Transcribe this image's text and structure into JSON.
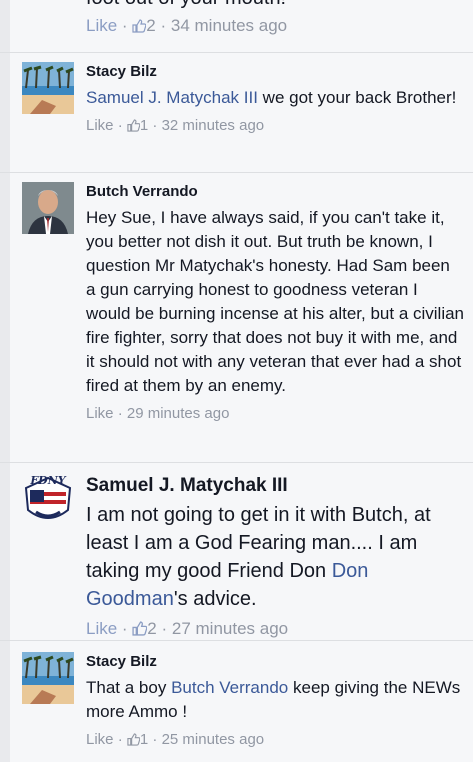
{
  "top_fragment": {
    "text": "foot out of your mouth!",
    "meta": {
      "like": "Like",
      "sep": " · ",
      "count": "2",
      "time": "34 minutes ago"
    }
  },
  "comments": [
    {
      "name": "Stacy Bilz",
      "mention": "Samuel J. Matychak III",
      "text": " we got your back Brother!",
      "meta": {
        "like": "Like",
        "sep": " · ",
        "count": "1",
        "time": "32 minutes ago"
      }
    },
    {
      "name": "Butch Verrando",
      "text": "Hey Sue, I have always said, if you can't take it, you better not dish it out. But truth be known, I question Mr Matychak's honesty. Had Sam been a gun carrying honest to goodness veteran I would be burning incense at his alter, but a civilian fire fighter, sorry that does not buy it with me, and it should not with any veteran that ever had a shot fired at them by an enemy.",
      "meta": {
        "like": "Like",
        "sep": " · ",
        "time": "29 minutes ago"
      }
    },
    {
      "name": "Samuel J. Matychak III",
      "text_before": "I am not going to get in it with Butch, at least I am a God Fearing man.... I am taking my good Friend Don ",
      "mention": "Don Goodman",
      "text_after": "'s advice.",
      "meta": {
        "like": "Like",
        "sep": " · ",
        "count": "2",
        "time": "27 minutes ago"
      },
      "avatar_text": "FDNY"
    },
    {
      "name": "Stacy Bilz",
      "text_before": "That a boy ",
      "mention": "Butch Verrando",
      "text_after": " keep giving the NEWs more Ammo !",
      "meta": {
        "like": "Like",
        "sep": " · ",
        "count": "1",
        "time": "25 minutes ago"
      }
    }
  ],
  "colors": {
    "link": "#3b5998",
    "meta": "#9197a3",
    "background": "#f6f7f9"
  },
  "icons": [
    "thumbs-up-icon"
  ]
}
